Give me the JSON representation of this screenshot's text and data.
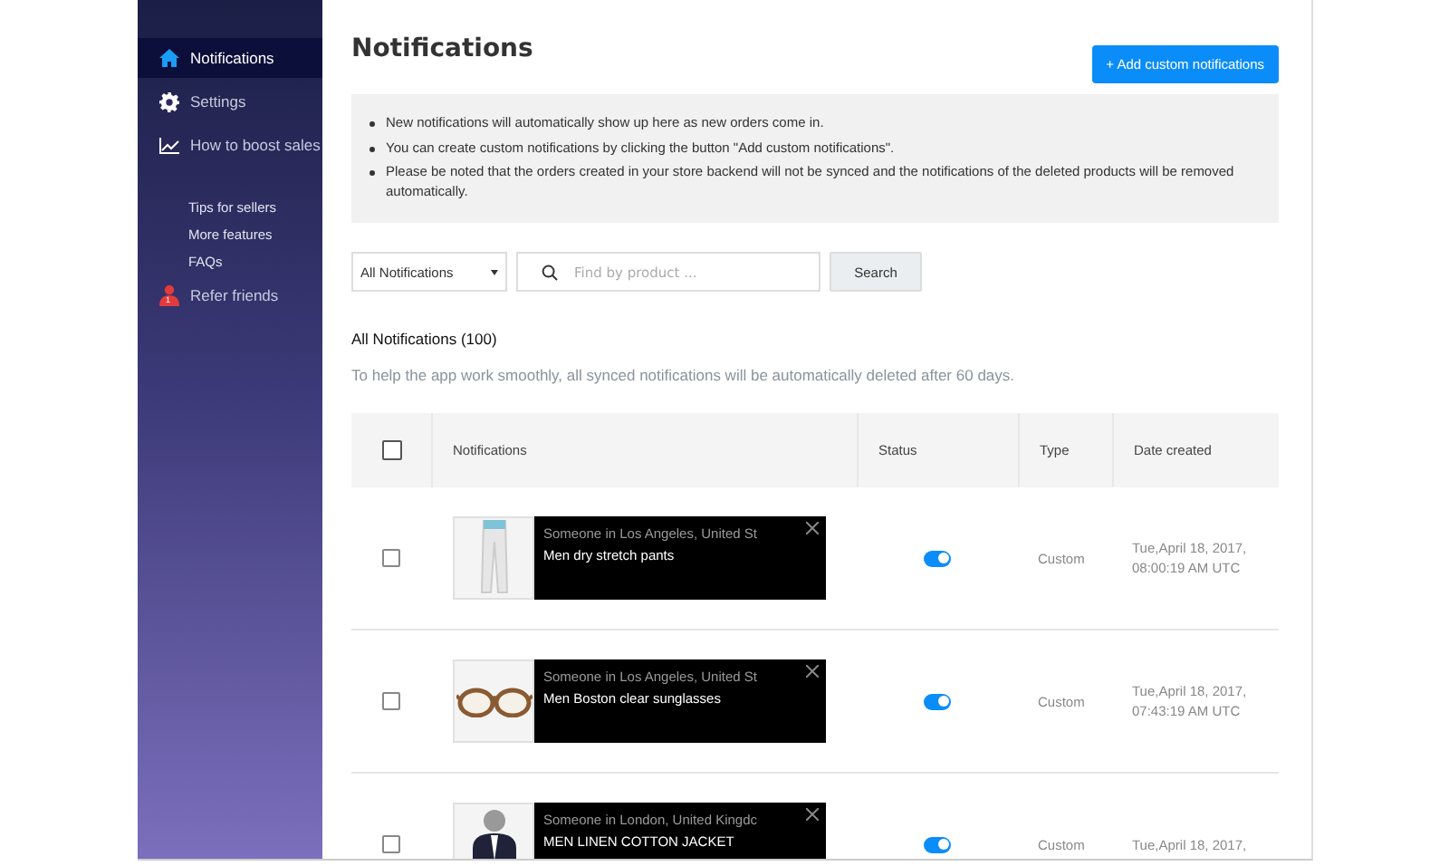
{
  "sidebar": {
    "items": [
      {
        "label": "Notifications",
        "selected": true
      },
      {
        "label": "Settings",
        "selected": false
      },
      {
        "label": "How to boost sales",
        "selected": false
      }
    ],
    "links": [
      "Tips for sellers",
      "More features",
      "FAQs"
    ],
    "refer": {
      "label": "Refer friends",
      "badge": "1"
    }
  },
  "page": {
    "title": "Notifications",
    "add_button": "+ Add custom notifications",
    "info": [
      "New notifications will automatically show up here as new orders come in.",
      "You can create custom notifications by clicking the button \"Add custom notifications\".",
      "Please be noted that the orders created in your store backend will not be synced and the notifications of the deleted products will be removed automatically."
    ]
  },
  "filters": {
    "dropdown": "All Notifications",
    "search_placeholder": "Find by product ...",
    "search_button": "Search"
  },
  "list": {
    "heading": "All Notifications (100)",
    "note": "To help the app work smoothly, all synced notifications will be automatically deleted after 60 days."
  },
  "table": {
    "columns": [
      "Notifications",
      "Status",
      "Type",
      "Date created"
    ],
    "select_all_checked": false,
    "rows": [
      {
        "checked": false,
        "line1": "Someone in Los Angeles, United St",
        "line2": "Men dry stretch pants",
        "on": true,
        "type": "Custom",
        "date": [
          "Tue,April 18, 2017,",
          "08:00:19 AM UTC"
        ]
      },
      {
        "checked": false,
        "line1": "Someone in Los Angeles, United St",
        "line2": "Men Boston clear sunglasses",
        "on": true,
        "type": "Custom",
        "date": [
          "Tue,April 18, 2017,",
          "07:43:19 AM UTC"
        ]
      },
      {
        "checked": false,
        "line1": "Someone in London, United Kingdc",
        "line2": "MEN LINEN COTTON JACKET",
        "on": true,
        "type": "Custom",
        "date": [
          "Tue,April 18, 2017,"
        ]
      }
    ]
  }
}
